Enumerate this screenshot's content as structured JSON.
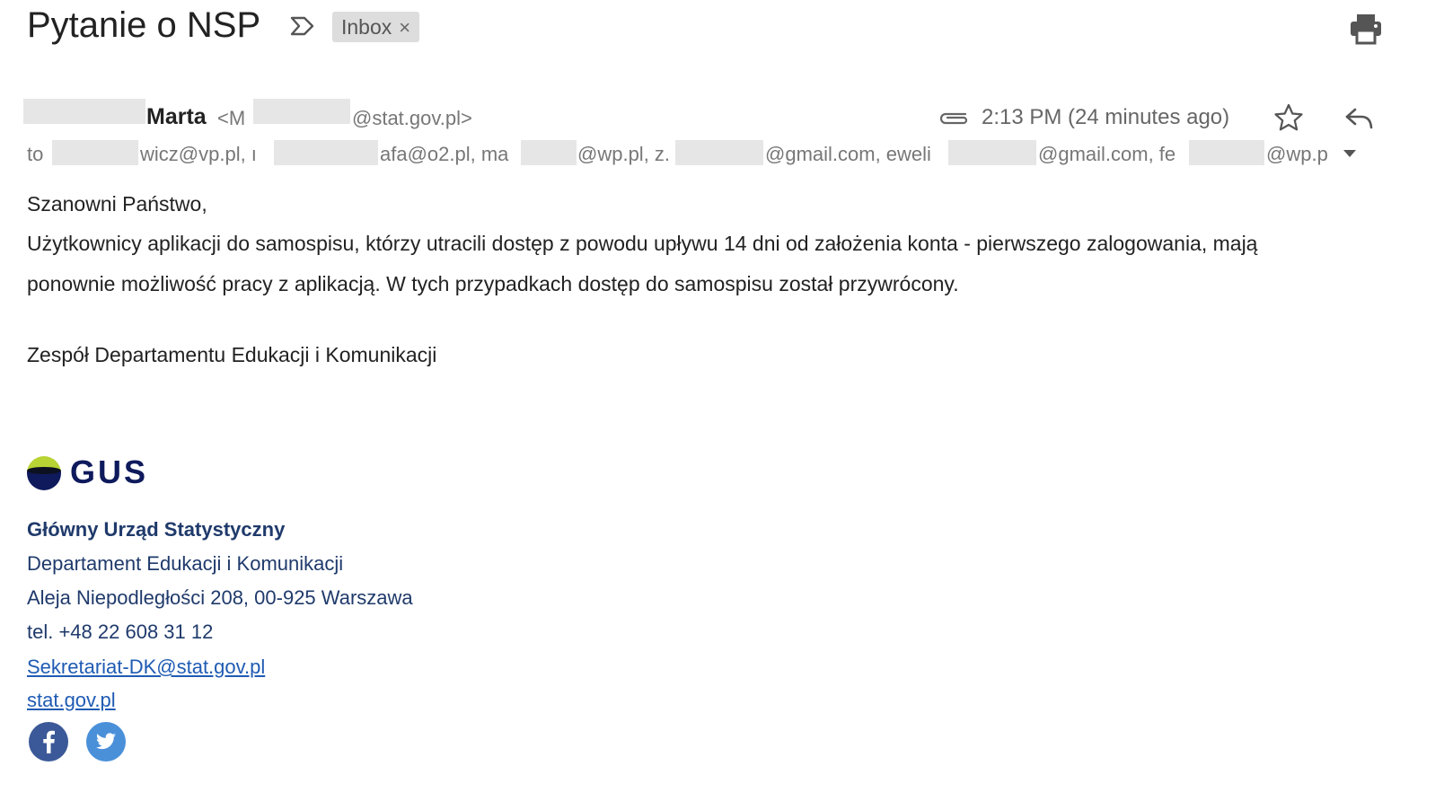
{
  "header": {
    "subject": "Pytanie o NSP",
    "label": "Inbox",
    "label_close": "×"
  },
  "sender": {
    "name": "Marta",
    "email_prefix": "<M",
    "email_domain": "@stat.gov.pl>",
    "time": "2:13 PM (24 minutes ago)"
  },
  "recipients": {
    "to_label": "to",
    "parts": [
      "wicz@vp.pl, ı",
      "afa@o2.pl, ma",
      "@wp.pl, z.",
      "@gmail.com, eweli",
      "@gmail.com, fe",
      "@wp.p"
    ]
  },
  "body": {
    "greeting": "Szanowni Państwo,",
    "line1": "Użytkownicy aplikacji do samospisu, którzy utracili dostęp z powodu upływu 14 dni od założenia konta - pierwszego zalogowania, mają",
    "line2": "ponownie możliwość pracy z aplikacją. W tych przypadkach dostęp do samospisu został przywrócony.",
    "closing": "Zespół Departamentu Edukacji i Komunikacji"
  },
  "signature": {
    "logo_text": "GUS",
    "org": "Główny Urząd Statystyczny",
    "dept": "Departament Edukacji i Komunikacji",
    "address": "Aleja Niepodległości 208, 00-925 Warszawa",
    "phone": "tel. +48 22 608 31 12",
    "email": "Sekretariat-DK@stat.gov.pl",
    "website": "stat.gov.pl"
  },
  "colors": {
    "accent_link": "#1f5bb3",
    "signature_text": "#1f3a6b",
    "logo_green": "#b8d334",
    "logo_navy": "#0e1a5c",
    "facebook": "#3b5998",
    "twitter": "#4a90d9"
  },
  "icons": [
    "important-marker-icon",
    "print-icon",
    "attachment-icon",
    "star-icon",
    "reply-icon",
    "chevron-down-icon",
    "facebook-icon",
    "twitter-icon"
  ]
}
